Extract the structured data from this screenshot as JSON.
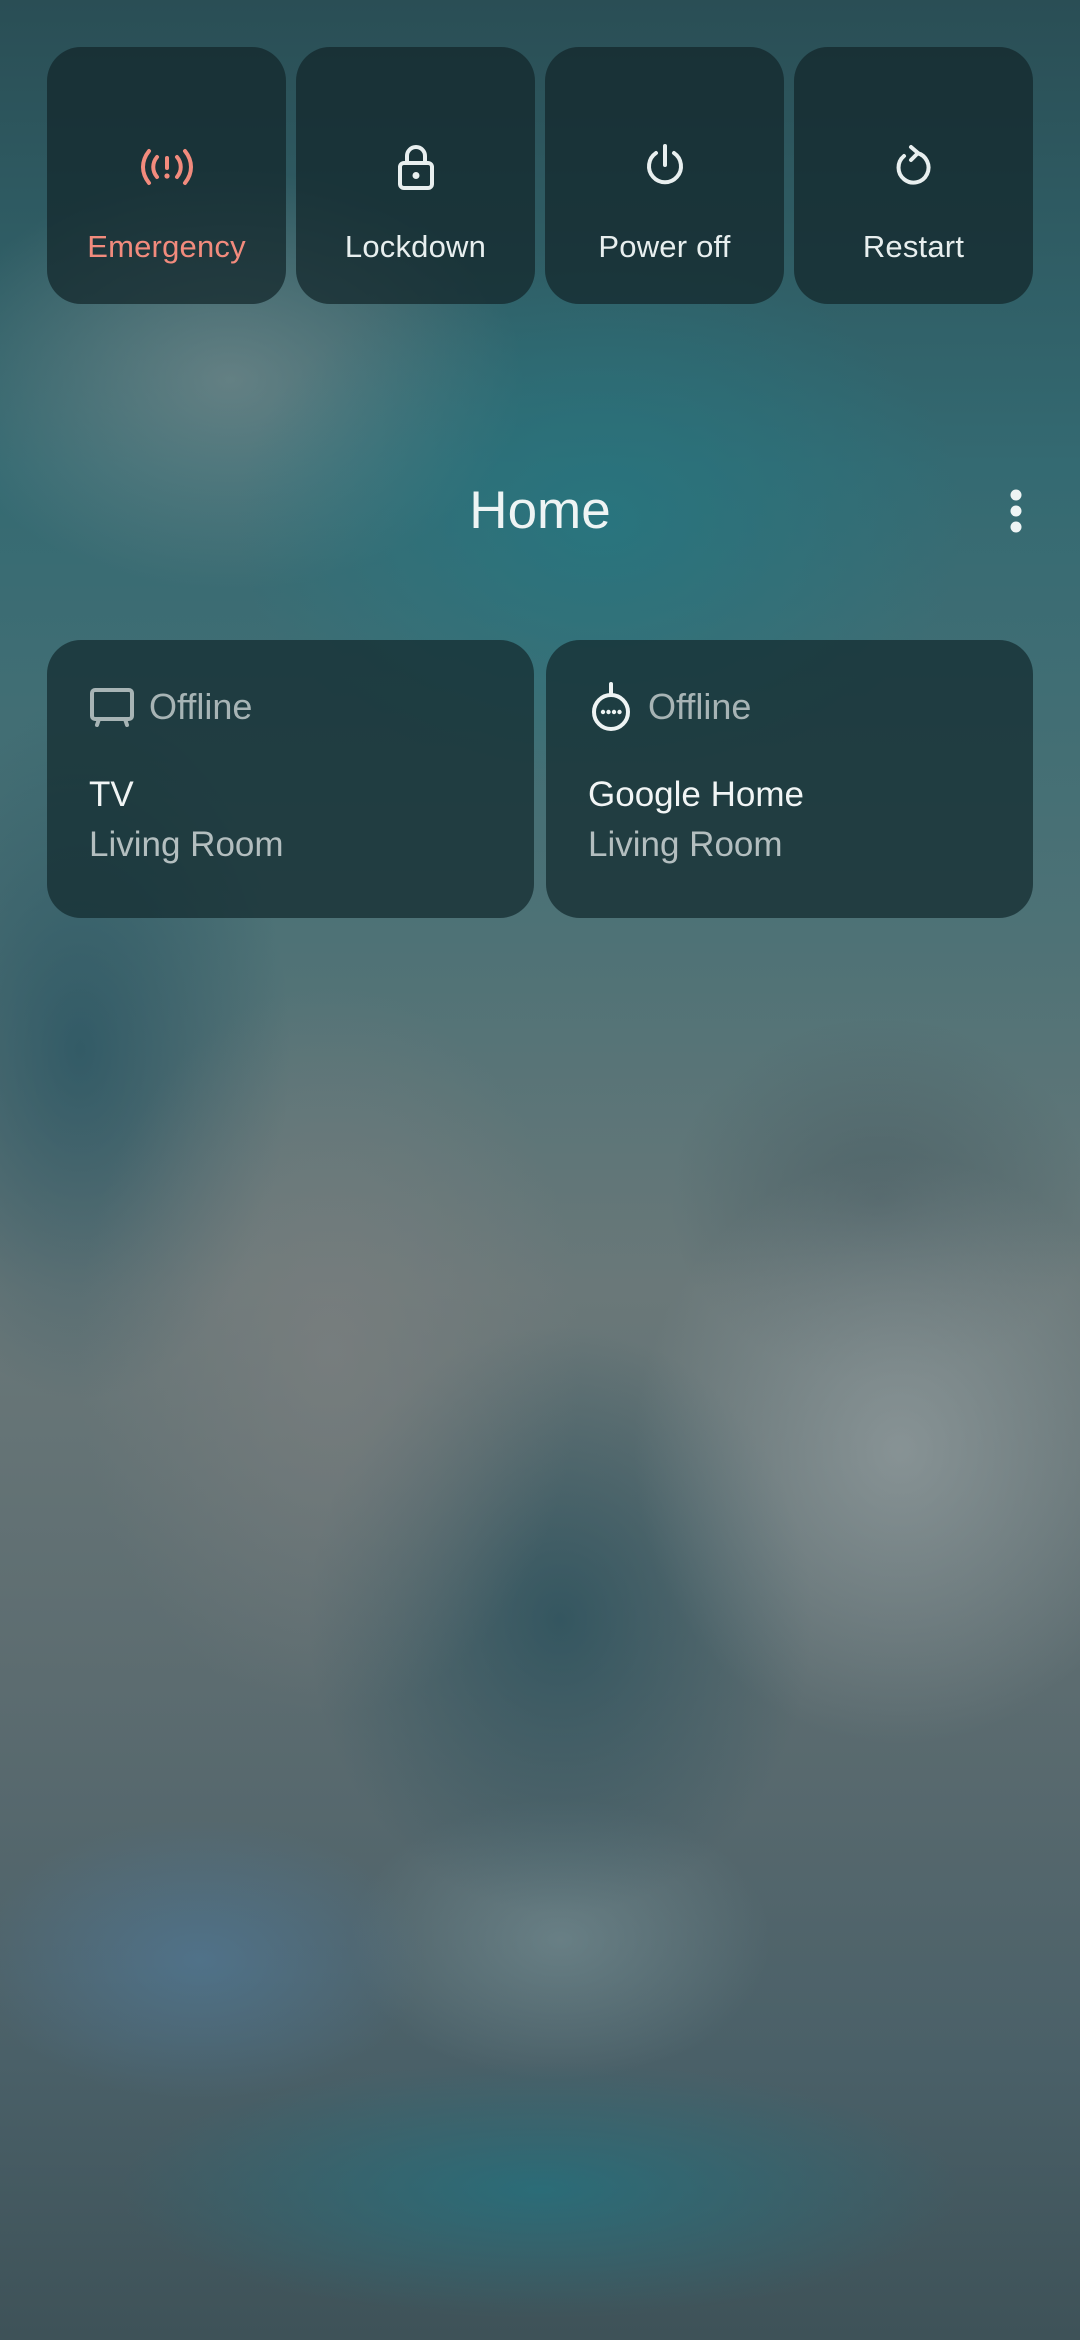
{
  "power_menu": {
    "buttons": [
      {
        "label": "Emergency",
        "icon": "emergency-broadcast-icon",
        "color": "#f28b7d"
      },
      {
        "label": "Lockdown",
        "icon": "lock-icon"
      },
      {
        "label": "Power off",
        "icon": "power-icon"
      },
      {
        "label": "Restart",
        "icon": "restart-icon"
      }
    ]
  },
  "controls": {
    "title": "Home",
    "more_icon": "more-vert-icon",
    "devices": [
      {
        "status": "Offline",
        "name": "TV",
        "room": "Living Room",
        "icon": "tv-icon"
      },
      {
        "status": "Offline",
        "name": "Google Home",
        "room": "Living Room",
        "icon": "smart-speaker-icon"
      }
    ]
  }
}
